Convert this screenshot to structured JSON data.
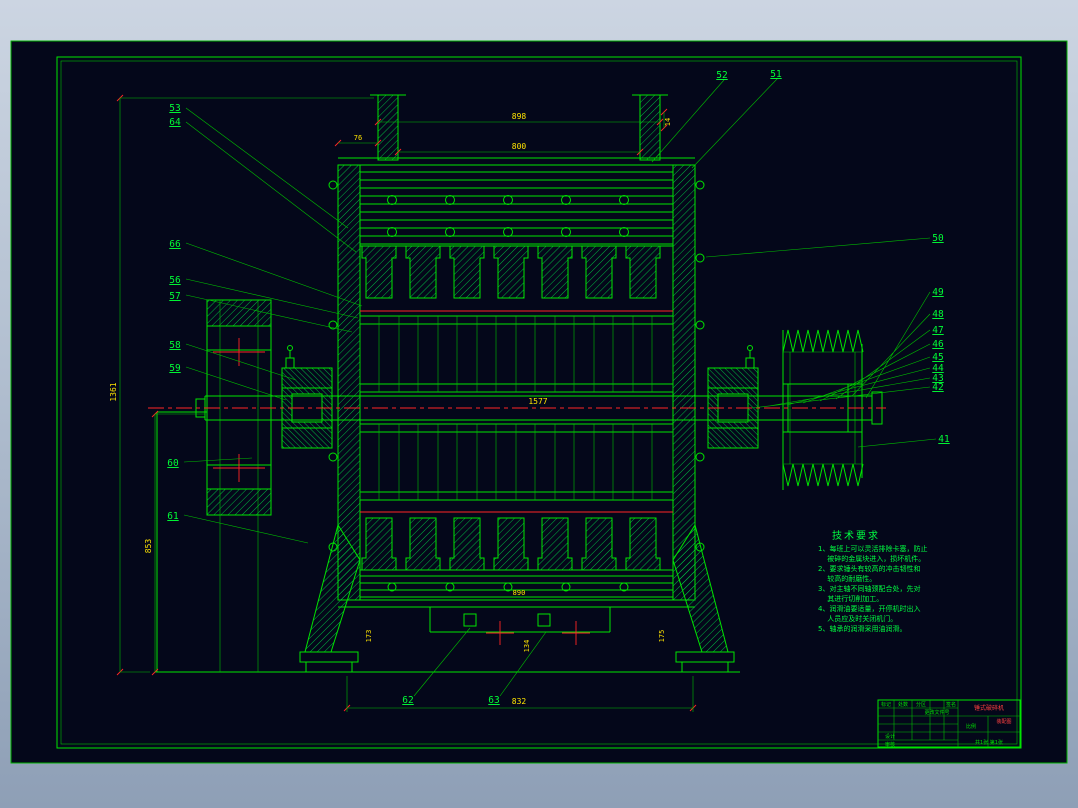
{
  "callouts": {
    "53": "53",
    "64": "64",
    "66": "66",
    "56": "56",
    "57": "57",
    "58": "58",
    "59": "59",
    "60": "60",
    "61": "61",
    "52": "52",
    "51": "51",
    "50": "50",
    "49": "49",
    "48": "48",
    "47": "47",
    "46": "46",
    "45": "45",
    "44": "44",
    "43": "43",
    "42": "42",
    "41": "41",
    "62": "62",
    "63": "63"
  },
  "dimensions": {
    "top_outer": "898",
    "top_inner": "800",
    "wall_offset": "76",
    "chute_side": "14",
    "shaft_length": "1577",
    "overall_height": "1361",
    "pedestal_height": "853",
    "base_span": "832",
    "grate_width": "890",
    "left_leg": "173",
    "right_leg": "175",
    "discharge_depth": "134"
  },
  "tech_requirements": {
    "title": "技术要求",
    "lines": [
      "1、每班上可以灵活排除卡塞，防止",
      "　 被碎的金属块进入，损坏机件。",
      "2、要求锤头有较高的冲击韧性和",
      "　 较高的耐磨性。",
      "3、对主轴不同轴颈配合处，先对",
      "　 其进行切削加工。",
      "4、润滑油要适量，开停机时出入",
      "　 人员应及时关闭机门。",
      "5、轴承的润滑采用油润滑。"
    ]
  },
  "title_block": {
    "part_name": "锤式破碎机",
    "subtitle": "装配图",
    "header": [
      "标记",
      "处数",
      "分区",
      "更改文件号",
      "签名"
    ],
    "rows": [
      "设计",
      "审核"
    ],
    "scale_label": "比例",
    "sheet": "共1张 第1张"
  }
}
